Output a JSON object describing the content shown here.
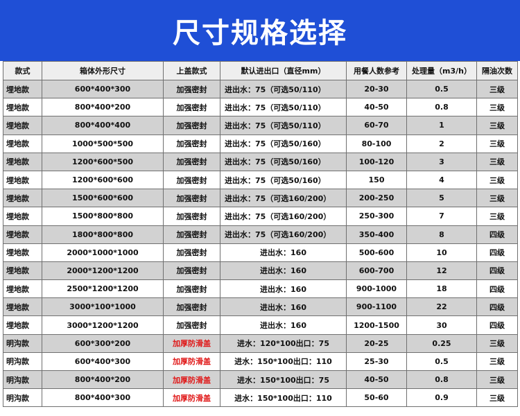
{
  "title": "尺寸规格选择",
  "colors": {
    "banner": "#1f4fd6",
    "highlight_text": "#e01818"
  },
  "headers": [
    "款式",
    "箱体外形尺寸",
    "上盖款式",
    "默认进出口（直径mm）",
    "用餐人数参考",
    "处理量（m3/h）",
    "隔油次数"
  ],
  "rows": [
    {
      "type": "埋地款",
      "dimension": "600*400*300",
      "lid": "加强密封",
      "port": "进出水：75（可选50/110）",
      "people": "20-30",
      "capacity": "0.5",
      "separation": "三级"
    },
    {
      "type": "埋地款",
      "dimension": "800*400*200",
      "lid": "加强密封",
      "port": "进出水：75（可选50/110）",
      "people": "40-50",
      "capacity": "0.8",
      "separation": "三级"
    },
    {
      "type": "埋地款",
      "dimension": "800*400*400",
      "lid": "加强密封",
      "port": "进出水：75（可选50/110）",
      "people": "60-70",
      "capacity": "1",
      "separation": "三级"
    },
    {
      "type": "埋地款",
      "dimension": "1000*500*500",
      "lid": "加强密封",
      "port": "进出水：75（可选50/160）",
      "people": "80-100",
      "capacity": "2",
      "separation": "三级"
    },
    {
      "type": "埋地款",
      "dimension": "1200*600*500",
      "lid": "加强密封",
      "port": "进出水：75（可选50/160）",
      "people": "100-120",
      "capacity": "3",
      "separation": "三级"
    },
    {
      "type": "埋地款",
      "dimension": "1200*600*600",
      "lid": "加强密封",
      "port": "进出水：75（可选50/160）",
      "people": "150",
      "capacity": "4",
      "separation": "三级"
    },
    {
      "type": "埋地款",
      "dimension": "1500*600*600",
      "lid": "加强密封",
      "port": "进出水：75（可选160/200）",
      "people": "200-250",
      "capacity": "5",
      "separation": "三级"
    },
    {
      "type": "埋地款",
      "dimension": "1500*800*800",
      "lid": "加强密封",
      "port": "进出水：75（可选160/200）",
      "people": "250-300",
      "capacity": "7",
      "separation": "三级"
    },
    {
      "type": "埋地款",
      "dimension": "1800*800*800",
      "lid": "加强密封",
      "port": "进出水：75（可选160/200）",
      "people": "350-400",
      "capacity": "8",
      "separation": "四级"
    },
    {
      "type": "埋地款",
      "dimension": "2000*1000*1000",
      "lid": "加强密封",
      "port": "进出水：160",
      "people": "500-600",
      "capacity": "10",
      "separation": "四级"
    },
    {
      "type": "埋地款",
      "dimension": "2000*1200*1200",
      "lid": "加强密封",
      "port": "进出水：160",
      "people": "600-700",
      "capacity": "12",
      "separation": "四级"
    },
    {
      "type": "埋地款",
      "dimension": "2500*1200*1200",
      "lid": "加强密封",
      "port": "进出水：160",
      "people": "900-1000",
      "capacity": "18",
      "separation": "四级"
    },
    {
      "type": "埋地款",
      "dimension": "3000*100*1000",
      "lid": "加强密封",
      "port": "进出水：160",
      "people": "900-1100",
      "capacity": "22",
      "separation": "四级"
    },
    {
      "type": "埋地款",
      "dimension": "3000*1200*1200",
      "lid": "加强密封",
      "port": "进出水：160",
      "people": "1200-1500",
      "capacity": "30",
      "separation": "四级"
    },
    {
      "type": "明沟款",
      "dimension": "600*300*200",
      "lid": "加厚防滑盖",
      "port": "进水：120*100出口：75",
      "people": "20-25",
      "capacity": "0.25",
      "separation": "三级"
    },
    {
      "type": "明沟款",
      "dimension": "600*400*300",
      "lid": "加厚防滑盖",
      "port": "进水：150*100出口：110",
      "people": "25-30",
      "capacity": "0.5",
      "separation": "三级"
    },
    {
      "type": "明沟款",
      "dimension": "800*400*200",
      "lid": "加厚防滑盖",
      "port": "进水：150*100出口：75",
      "people": "40-50",
      "capacity": "0.8",
      "separation": "三级"
    },
    {
      "type": "明沟款",
      "dimension": "800*400*300",
      "lid": "加厚防滑盖",
      "port": "进水：150*100出口：110",
      "people": "50-60",
      "capacity": "0.9",
      "separation": "三级"
    }
  ]
}
